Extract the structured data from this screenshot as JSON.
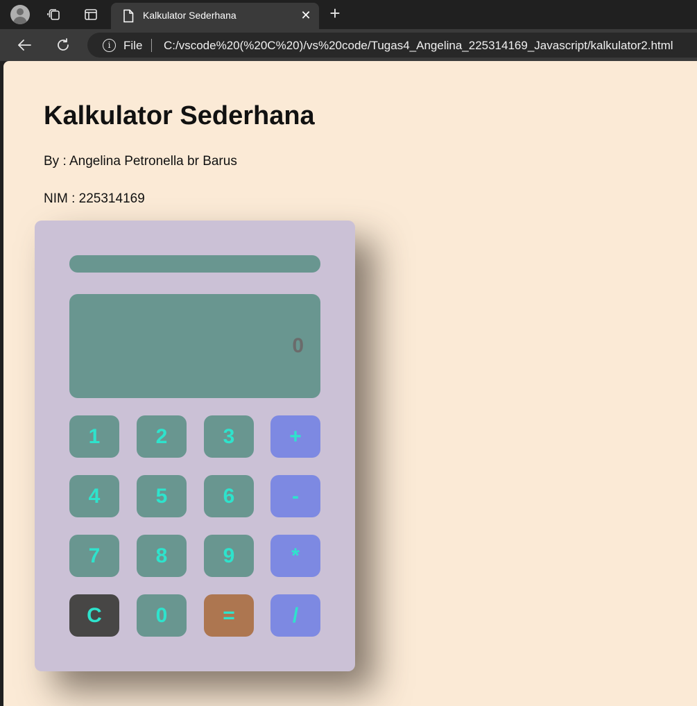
{
  "browser": {
    "tab_title": "Kalkulator Sederhana",
    "close_glyph": "✕",
    "new_tab_glyph": "+",
    "address_info_glyph": "i",
    "address_scheme": "File",
    "address_url": "C:/vscode%20(%20C%20)/vs%20code/Tugas4_Angelina_225314169_Javascript/kalkulator2.html"
  },
  "page": {
    "title": "Kalkulator Sederhana",
    "byline": "By : Angelina Petronella br Barus",
    "nim": "NIM : 225314169"
  },
  "calculator": {
    "display_value": "0",
    "keys": [
      [
        "1",
        "2",
        "3",
        "+"
      ],
      [
        "4",
        "5",
        "6",
        "-"
      ],
      [
        "7",
        "8",
        "9",
        "*"
      ],
      [
        "C",
        "0",
        "=",
        "/"
      ]
    ]
  },
  "colors": {
    "page_background": "#fbead6",
    "calculator_body": "#cbc1d6",
    "display": "#699690",
    "number_key": "#699690",
    "operator_key": "#7d89e2",
    "clear_key": "#474645",
    "equals_key": "#ad7650",
    "key_text": "#2ee3cc"
  }
}
